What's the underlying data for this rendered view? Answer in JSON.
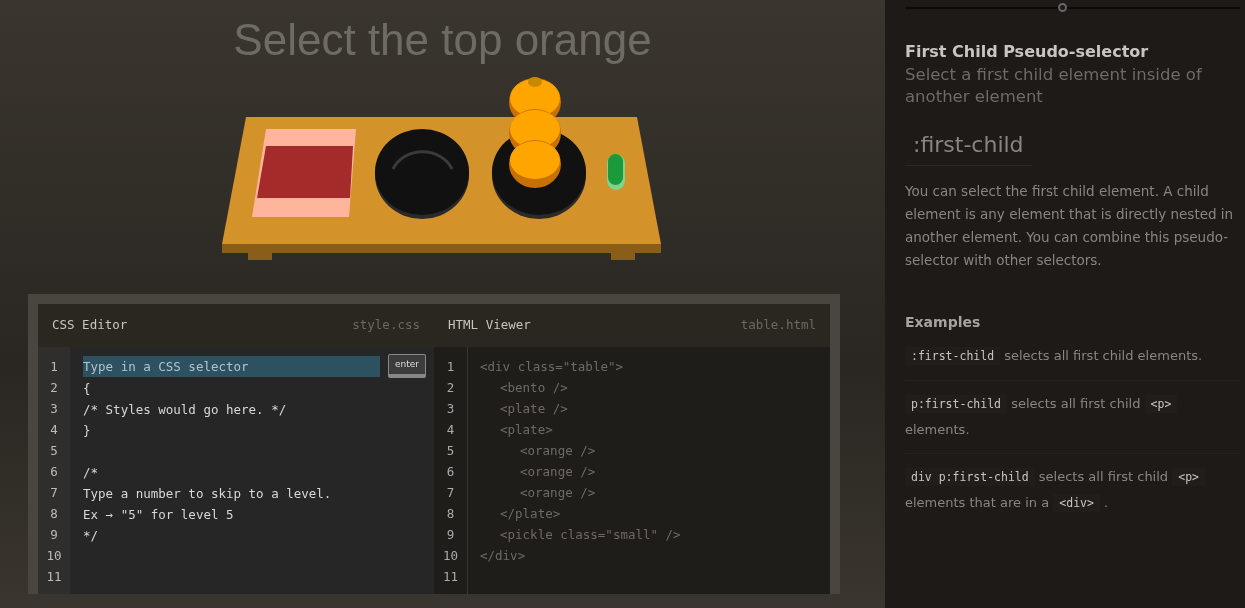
{
  "instruction": "Select the top orange",
  "table": {
    "items": [
      {
        "kind": "bento"
      },
      {
        "kind": "plate"
      },
      {
        "kind": "plate",
        "children": [
          {
            "kind": "orange"
          },
          {
            "kind": "orange"
          },
          {
            "kind": "orange"
          }
        ]
      },
      {
        "kind": "pickle"
      }
    ]
  },
  "css_editor": {
    "title": "CSS Editor",
    "file": "style.css",
    "line_numbers": [
      "1",
      "2",
      "3",
      "4",
      "5",
      "6",
      "7",
      "8",
      "9",
      "10",
      "11"
    ],
    "input": {
      "placeholder": "Type in a CSS selector"
    },
    "enter_button": "enter",
    "code_blocks": [
      [
        "{",
        "/* Styles would go here. */",
        "}"
      ],
      [
        "/*",
        "Type a number to skip to a level.",
        "Ex → \"5\" for level 5",
        "*/"
      ]
    ]
  },
  "html_viewer": {
    "title": "HTML Viewer",
    "file": "table.html",
    "line_numbers": [
      "1",
      "2",
      "3",
      "4",
      "5",
      "6",
      "7",
      "8",
      "9",
      "10",
      "11"
    ],
    "tree": [
      {
        "open": "<div class=\"table\">",
        "close": "</div>",
        "children": [
          {
            "open": "<bento />"
          },
          {
            "open": "<plate />"
          },
          {
            "open": "<plate>",
            "close": "</plate>",
            "children": [
              {
                "open": "<orange />"
              },
              {
                "open": "<orange />"
              },
              {
                "open": "<orange />"
              }
            ]
          },
          {
            "open": "<pickle class=\"small\" />"
          }
        ]
      }
    ]
  },
  "sidebar": {
    "progress": {
      "level": 0.47
    },
    "title": "First Child Pseudo-selector",
    "subtitle": "Select a first child element inside of another element",
    "syntax": ":first-child",
    "description": "You can select the first child element. A child element is any element that is directly nested in another element. You can combine this pseudo-selector with other selectors.",
    "examples_heading": "Examples",
    "examples": [
      [
        {
          "kind": "code",
          "text": ":first-child"
        },
        {
          "kind": "text",
          "text": "selects all first child elements."
        }
      ],
      [
        {
          "kind": "code",
          "text": "p:first-child"
        },
        {
          "kind": "text",
          "text": "selects all first child"
        },
        {
          "kind": "code",
          "text": "<p>"
        },
        {
          "kind": "text",
          "text": "elements."
        }
      ],
      [
        {
          "kind": "code",
          "text": "div p:first-child"
        },
        {
          "kind": "text",
          "text": "selects all first child"
        },
        {
          "kind": "code",
          "text": "<p>"
        },
        {
          "kind": "text",
          "text": "elements that are in a"
        },
        {
          "kind": "code",
          "text": "<div>"
        },
        {
          "kind": "text",
          "text": "."
        }
      ]
    ]
  }
}
